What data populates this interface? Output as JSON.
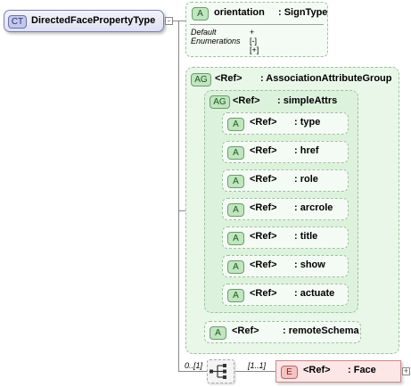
{
  "complex_type": {
    "badge": "CT",
    "name": "DirectedFacePropertyType"
  },
  "orientation": {
    "badge": "A",
    "name": "orientation",
    "type": ": SignType",
    "default_label": "Default",
    "enumerations_label": "Enumerations",
    "default_value": "+",
    "enum_values": [
      "[-]",
      "[+]"
    ]
  },
  "association_group": {
    "badge": "AG",
    "ref": "<Ref>",
    "name": ": AssociationAttributeGroup"
  },
  "simple_attrs": {
    "badge": "AG",
    "ref": "<Ref>",
    "name": ": simpleAttrs"
  },
  "attributes": [
    {
      "badge": "A",
      "ref": "<Ref>",
      "name": ": type"
    },
    {
      "badge": "A",
      "ref": "<Ref>",
      "name": ": href"
    },
    {
      "badge": "A",
      "ref": "<Ref>",
      "name": ": role"
    },
    {
      "badge": "A",
      "ref": "<Ref>",
      "name": ": arcrole"
    },
    {
      "badge": "A",
      "ref": "<Ref>",
      "name": ": title"
    },
    {
      "badge": "A",
      "ref": "<Ref>",
      "name": ": show"
    },
    {
      "badge": "A",
      "ref": "<Ref>",
      "name": ": actuate"
    }
  ],
  "remote_schema": {
    "badge": "A",
    "ref": "<Ref>",
    "name": ": remoteSchema"
  },
  "choice": {
    "cardinality": "0..[1]"
  },
  "face_element": {
    "badge": "E",
    "ref": "<Ref>",
    "name": ": Face",
    "cardinality": "[1..1]"
  }
}
